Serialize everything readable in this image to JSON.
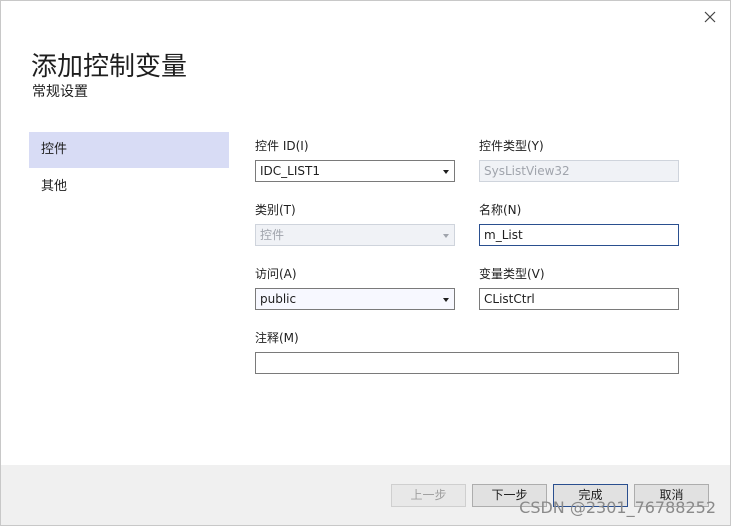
{
  "dialog": {
    "title": "添加控制变量",
    "subtitle": "常规设置",
    "close_icon": "close-icon"
  },
  "nav": {
    "items": [
      {
        "label": "控件",
        "active": true
      },
      {
        "label": "其他",
        "active": false
      }
    ]
  },
  "form": {
    "control_id": {
      "label": "控件 ID(I)",
      "value": "IDC_LIST1"
    },
    "control_type": {
      "label": "控件类型(Y)",
      "value": "SysListView32"
    },
    "category": {
      "label": "类别(T)",
      "value": "控件"
    },
    "name": {
      "label": "名称(N)",
      "value": "m_List"
    },
    "access": {
      "label": "访问(A)",
      "value": "public"
    },
    "var_type": {
      "label": "变量类型(V)",
      "value": "CListCtrl"
    },
    "comment": {
      "label": "注释(M)",
      "value": ""
    }
  },
  "footer": {
    "prev_label": "上一步",
    "next_label": "下一步",
    "finish_label": "完成",
    "cancel_label": "取消"
  },
  "watermark": "CSDN @2301_76788252",
  "colors": {
    "nav_active_bg": "#d8dcf5",
    "footer_bg": "#f0f0f0",
    "focus_border": "#2a4f8f"
  }
}
